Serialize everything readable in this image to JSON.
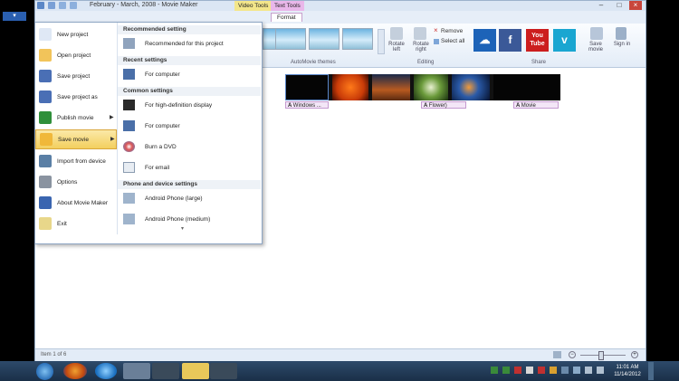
{
  "window": {
    "title": "February - March, 2008 - Movie Maker",
    "context_tabs": [
      "Video Tools",
      "Text Tools"
    ],
    "format_tab": "Format",
    "file_button": "▾"
  },
  "ribbon": {
    "groups": {
      "themes": "AutoMovie themes",
      "editing": "Editing",
      "share": "Share"
    },
    "rotate_left": "Rotate left",
    "rotate_right": "Rotate right",
    "remove": "Remove",
    "select_all": "Select all",
    "save_movie": "Save movie",
    "sign_in": "Sign in",
    "share_icons": [
      {
        "name": "skydrive",
        "glyph": "☁",
        "color": "#1d63b8"
      },
      {
        "name": "facebook",
        "glyph": "f",
        "color": "#3b5998"
      },
      {
        "name": "youtube",
        "glyph": "You\nTube",
        "color": "#cc1e1e"
      },
      {
        "name": "vimeo",
        "glyph": "v",
        "color": "#1aa6d1"
      }
    ]
  },
  "storyboard": {
    "captions": [
      "Windows ...",
      "Flower)",
      "Movie"
    ]
  },
  "status": {
    "item_count": "Item 1 of 6"
  },
  "file_menu": {
    "items": [
      {
        "label": "New project",
        "color": "#dfe8f5"
      },
      {
        "label": "Open project",
        "color": "#f2c45a"
      },
      {
        "label": "Save project",
        "color": "#4a6fb5"
      },
      {
        "label": "Save project as",
        "color": "#4a6fb5"
      },
      {
        "label": "Publish movie",
        "color": "#2f8f3a",
        "arrow": "▶"
      },
      {
        "label": "Save movie",
        "color": "#f0b83a",
        "arrow": "▶"
      },
      {
        "label": "Import from device",
        "color": "#5a7fa5"
      },
      {
        "label": "Options",
        "color": "#8a93a0"
      },
      {
        "label": "About Movie Maker",
        "color": "#3a65b0"
      },
      {
        "label": "Exit",
        "color": "#e8d78a"
      }
    ],
    "submenu": {
      "sections": {
        "recommended": "Recommended setting",
        "recent": "Recent settings",
        "common": "Common settings",
        "phone": "Phone and device settings"
      },
      "items": {
        "recommended_for_project": "Recommended for this project",
        "recent_for_computer": "For computer",
        "hd_display": "For high-definition display",
        "for_computer": "For computer",
        "burn_dvd": "Burn a DVD",
        "for_email": "For email",
        "android_large": "Android Phone (large)",
        "android_medium": "Android Phone (medium)"
      },
      "more_arrow": "▾"
    }
  },
  "taskbar": {
    "time": "11:01 AM",
    "date": "11/14/2012"
  }
}
